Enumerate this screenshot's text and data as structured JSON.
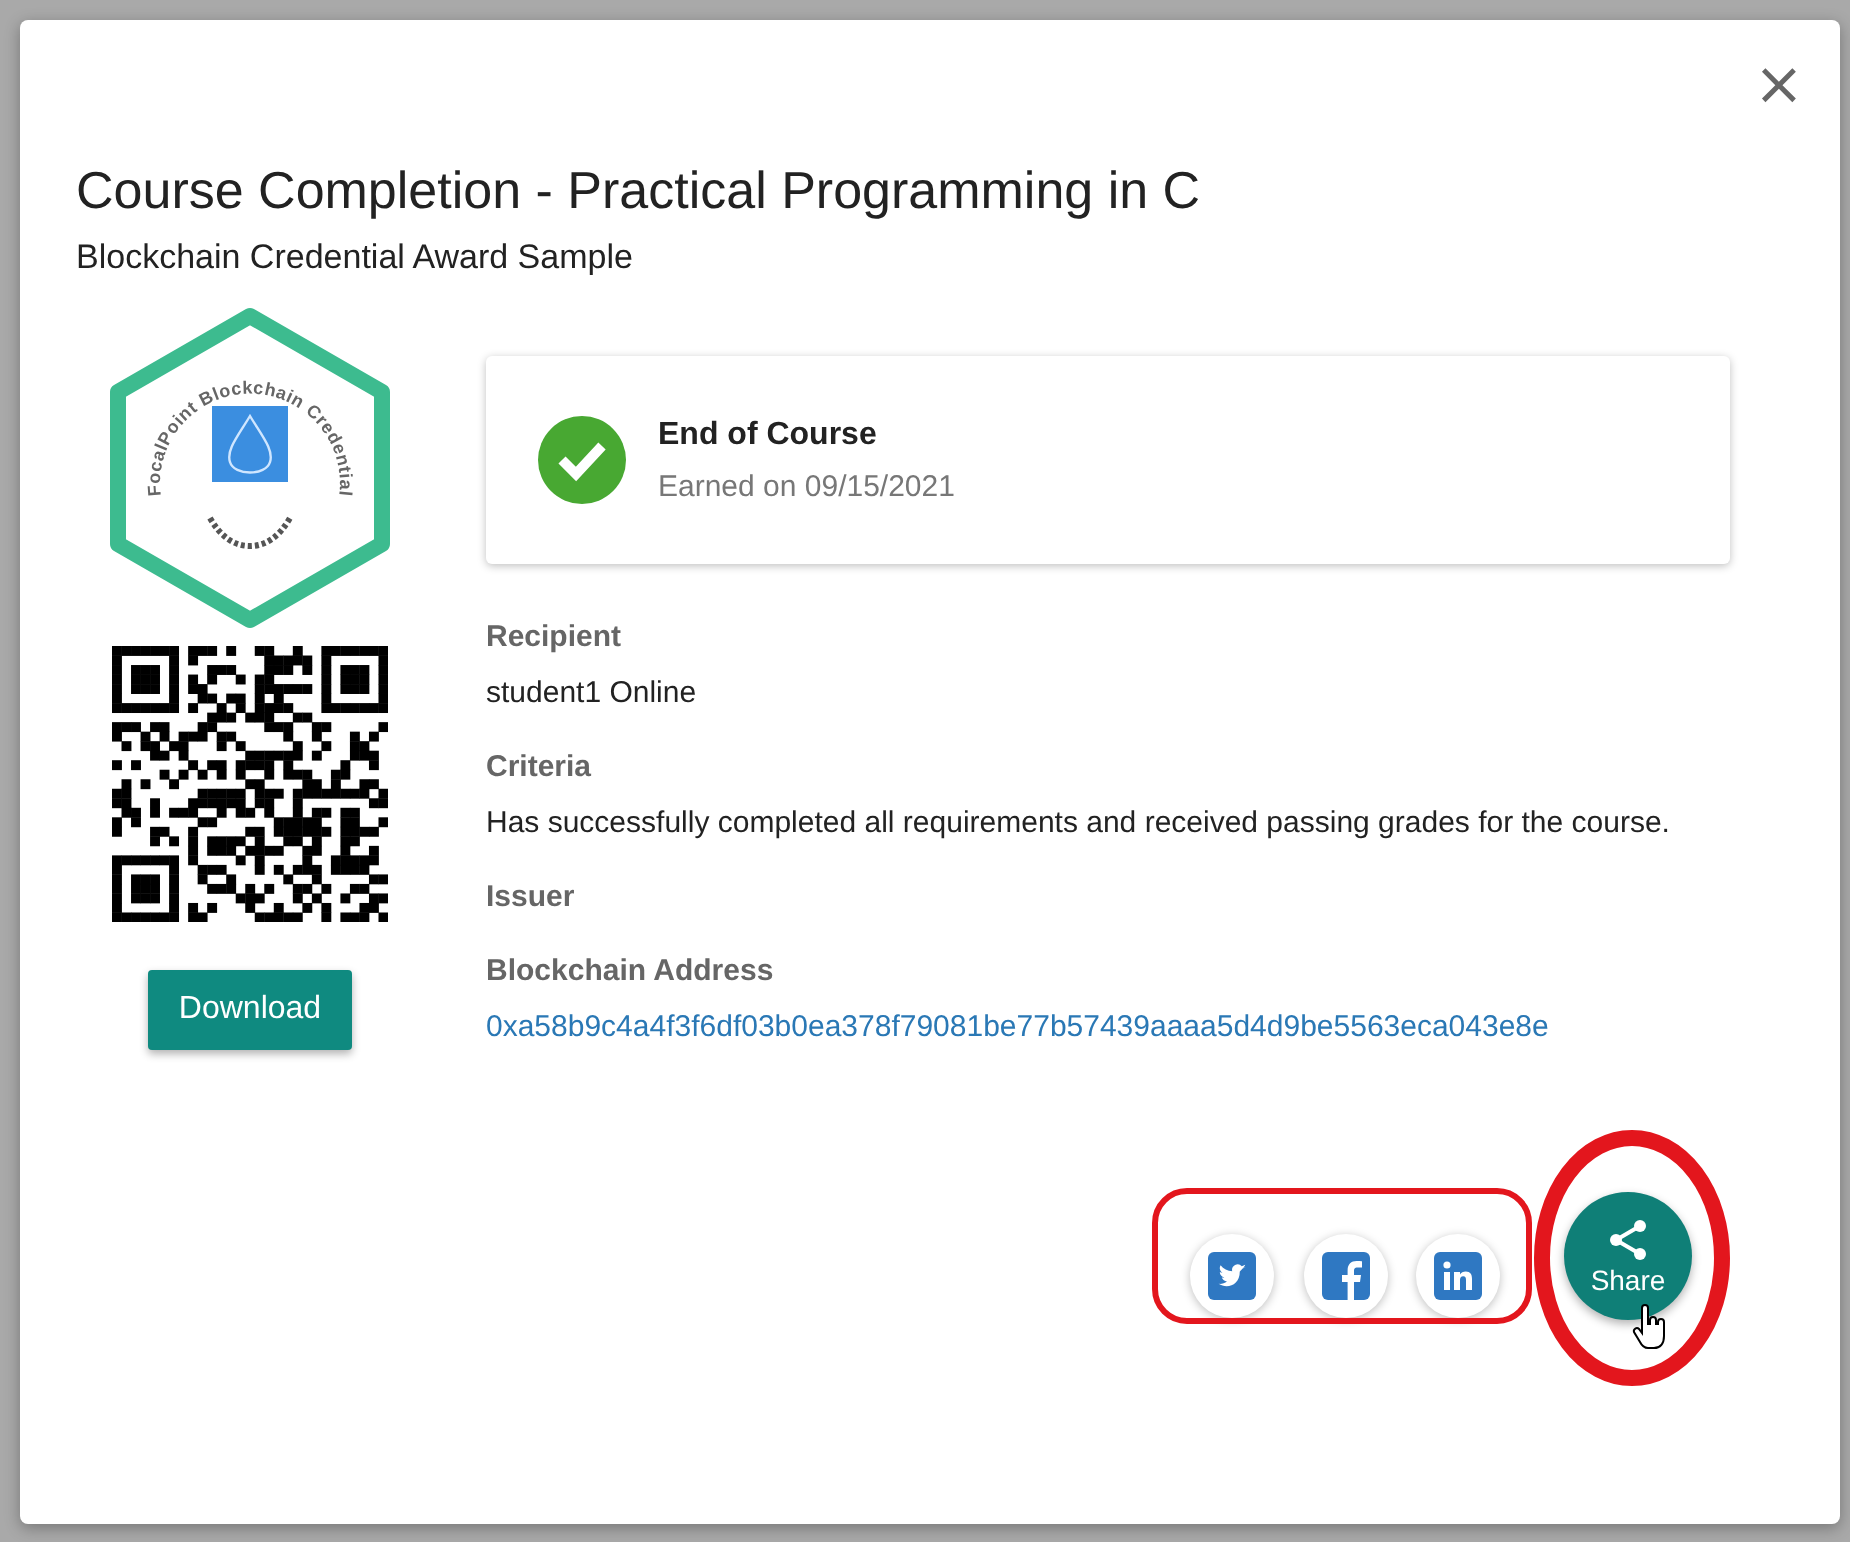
{
  "dialog": {
    "title": "Course Completion - Practical Programming in C",
    "subtitle": "Blockchain Credential Award Sample",
    "close_glyph": "×"
  },
  "badge": {
    "ring_text": "FocalPoint Blockchain Credential"
  },
  "download_button": "Download",
  "achievement": {
    "title": "End of Course",
    "earned": "Earned on 09/15/2021",
    "verified": true
  },
  "fields": [
    {
      "label": "Recipient",
      "value": "student1 Online",
      "kind": "text"
    },
    {
      "label": "Criteria",
      "value": "Has successfully completed all requirements and received passing grades for the course.",
      "kind": "text"
    },
    {
      "label": "Issuer"
    },
    {
      "label": "Blockchain Address",
      "value": "0xa58b9c4a4f3f6df03b0ea378f79081be77b57439aaaa5d4d9be5563eca043e8e",
      "kind": "link"
    }
  ],
  "social_buttons": [
    {
      "kind": "twitter"
    },
    {
      "kind": "facebook"
    },
    {
      "kind": "linkedin"
    }
  ],
  "share_button": {
    "label": "Share"
  },
  "annotations": {
    "social_highlight": true,
    "share_highlight": true
  }
}
